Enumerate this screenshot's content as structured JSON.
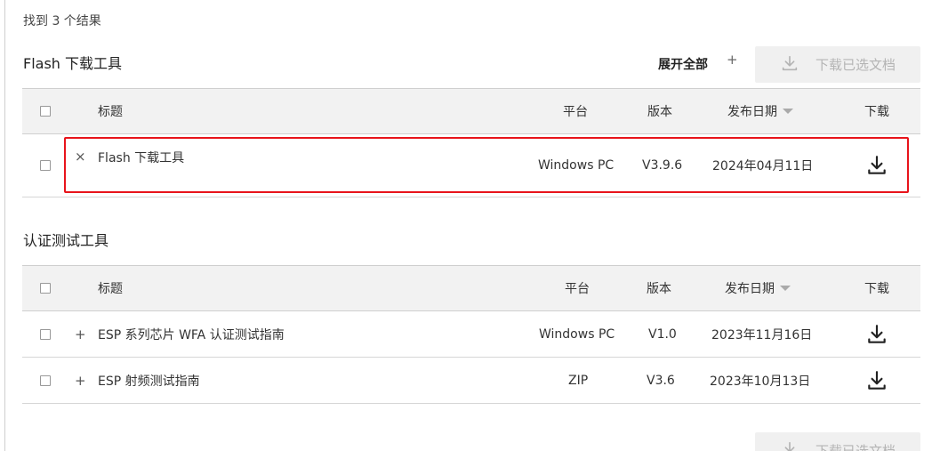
{
  "result_count": "找到 3 个结果",
  "toolbar": {
    "expand_all": "展开全部",
    "expand_plus": "+",
    "download_selected": "下载已选文档"
  },
  "columns": {
    "title": "标题",
    "platform": "平台",
    "version": "版本",
    "date": "发布日期",
    "download": "下载"
  },
  "groups": [
    {
      "name": "Flash 下载工具",
      "rows": [
        {
          "toggle": "×",
          "title": "Flash 下载工具",
          "platform": "Windows PC",
          "version": "V3.9.6",
          "date": "2024年04月11日",
          "highlighted": true
        }
      ]
    },
    {
      "name": "认证测试工具",
      "rows": [
        {
          "toggle": "+",
          "title": "ESP 系列芯片 WFA 认证测试指南",
          "platform": "Windows PC",
          "version": "V1.0",
          "date": "2023年11月16日"
        },
        {
          "toggle": "+",
          "title": "ESP 射频测试指南",
          "platform": "ZIP",
          "version": "V3.6",
          "date": "2023年10月13日"
        }
      ]
    }
  ],
  "icons": {
    "download": "download-icon",
    "sort": "sort-down-icon"
  },
  "colors": {
    "highlight": "#e8141b",
    "disabled_button_bg": "#f0f0f0",
    "disabled_button_text": "#b4b4b4"
  }
}
